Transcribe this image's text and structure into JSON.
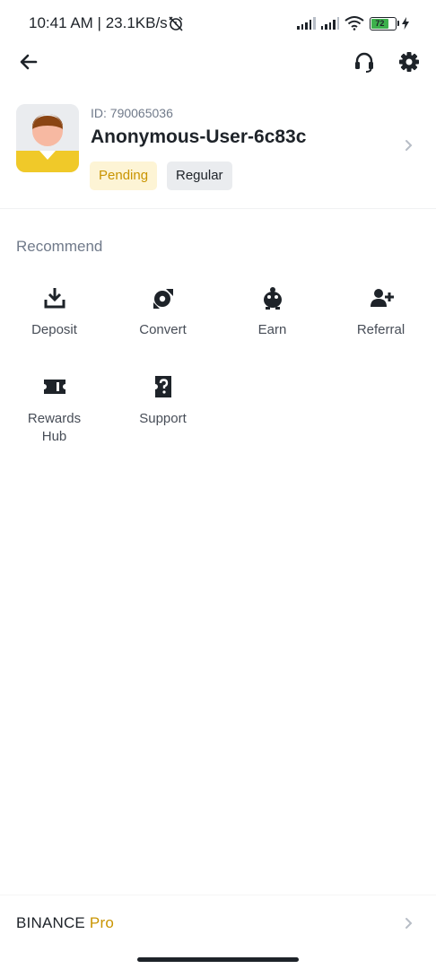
{
  "status_bar": {
    "time": "10:41 AM | 23.1KB/s",
    "battery_level": "72",
    "icons": [
      "mute-alarm-icon",
      "signal-icon",
      "signal-icon",
      "wifi-icon",
      "battery-icon",
      "charging-icon"
    ]
  },
  "nav": {
    "icons": [
      "back-arrow-icon",
      "headset-icon",
      "gear-icon"
    ]
  },
  "profile": {
    "id_text": "ID: 790065036",
    "username": "Anonymous-User-6c83c",
    "badges": [
      "Pending",
      "Regular"
    ]
  },
  "recommend": {
    "title": "Recommend",
    "items": [
      {
        "label": "Deposit",
        "icon": "deposit-icon"
      },
      {
        "label": "Convert",
        "icon": "convert-icon"
      },
      {
        "label": "Earn",
        "icon": "earn-icon"
      },
      {
        "label": "Referral",
        "icon": "referral-icon"
      },
      {
        "label": "Rewards\nHub",
        "icon": "rewards-hub-icon"
      },
      {
        "label": "Support",
        "icon": "support-icon"
      }
    ]
  },
  "footer": {
    "brand_main": "BINANCE",
    "brand_accent": "Pro"
  },
  "colors": {
    "accent": "#c99400",
    "pending_bg": "#fdf4d5",
    "text_primary": "#1e2329",
    "text_secondary": "#707a8a"
  }
}
